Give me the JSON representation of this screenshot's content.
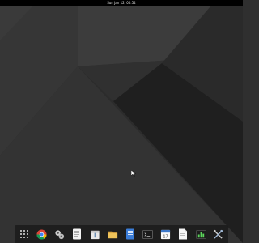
{
  "topbar": {
    "clock": "Sun Jan 12, 00:54"
  },
  "wallpaper": {
    "colors": [
      "#3a3a3a",
      "#343434",
      "#2e2e2e",
      "#282828",
      "#232323"
    ]
  },
  "dock": {
    "items": [
      {
        "name": "app-grid-icon"
      },
      {
        "name": "chrome-icon"
      },
      {
        "name": "settings-icon"
      },
      {
        "name": "text-editor-icon"
      },
      {
        "name": "archive-manager-icon"
      },
      {
        "name": "file-manager-icon"
      },
      {
        "name": "document-viewer-icon"
      },
      {
        "name": "terminal-icon"
      },
      {
        "name": "calendar-icon"
      },
      {
        "name": "document-icon"
      },
      {
        "name": "system-monitor-icon"
      },
      {
        "name": "tools-icon"
      }
    ],
    "calendar_day": "17"
  }
}
